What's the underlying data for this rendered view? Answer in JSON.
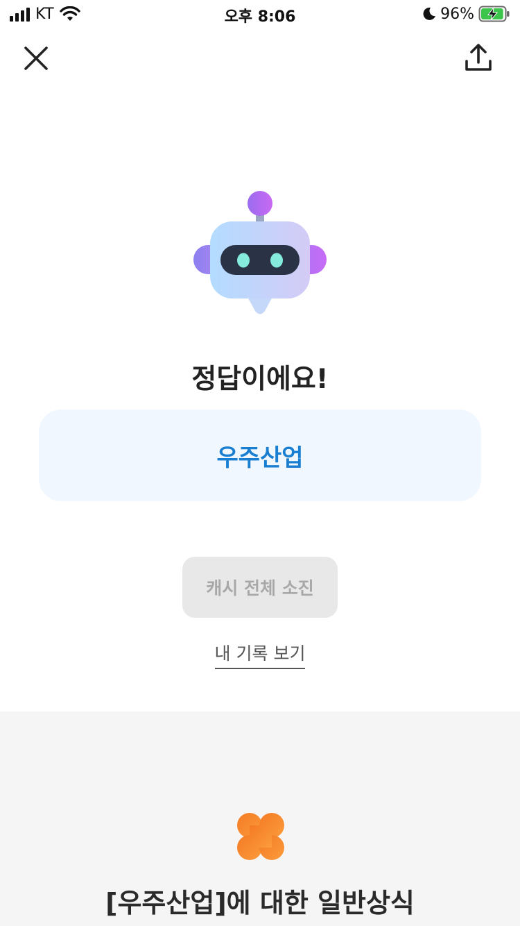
{
  "status_bar": {
    "carrier": "KT",
    "time": "오후 8:06",
    "battery_percent": "96%",
    "battery_level": 0.96,
    "charging": true,
    "icons": [
      "signal-icon",
      "wifi-icon",
      "moon-icon",
      "battery-charging-icon"
    ]
  },
  "nav": {
    "close_icon": "close-icon",
    "share_icon": "share-upload-icon"
  },
  "result": {
    "mascot_icon": "robot-mascot-icon",
    "title": "정답이에요!",
    "answer": "우주산업",
    "colors": {
      "answer_text": "#1a7fd1",
      "answer_bg": "#f0f7ff"
    }
  },
  "actions": {
    "cash_button_label": "캐시 전체 소진",
    "history_link_label": "내 기록 보기"
  },
  "info_section": {
    "icon": "clover-icon",
    "title": "[우주산업]에 대한 일반상식",
    "colors": {
      "clover": "#f5832a",
      "background": "#f5f5f5"
    }
  }
}
